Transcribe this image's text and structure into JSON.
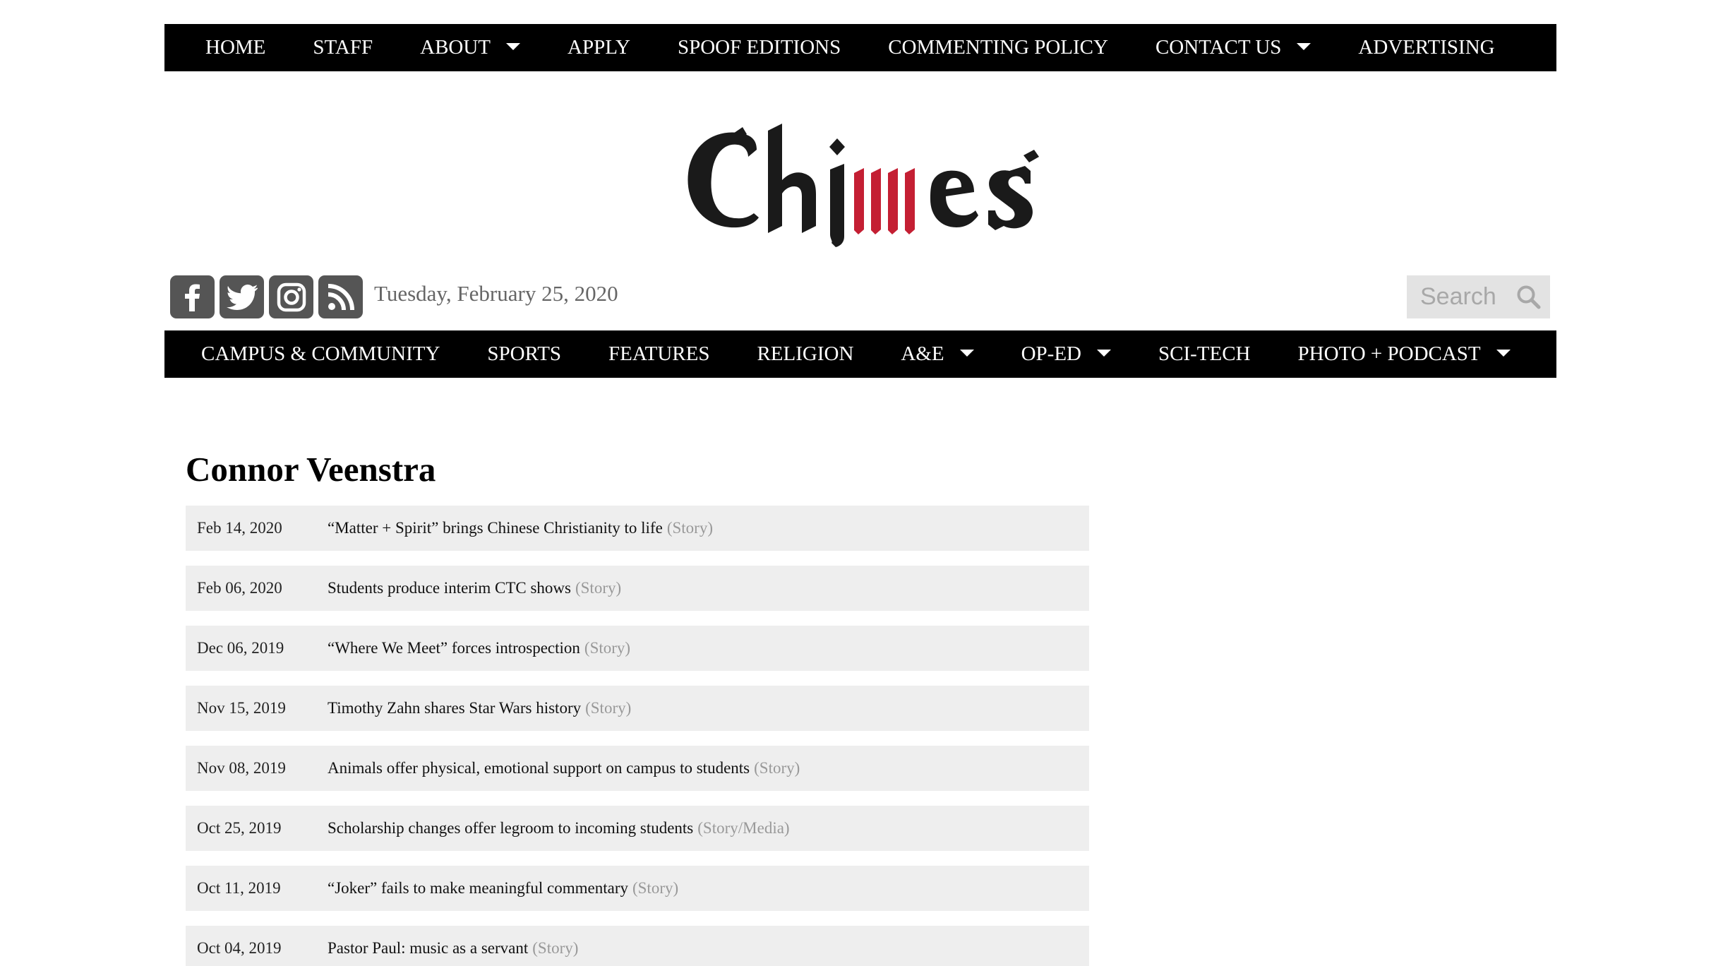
{
  "top_nav": [
    {
      "label": "HOME",
      "has_dropdown": false
    },
    {
      "label": "STAFF",
      "has_dropdown": false
    },
    {
      "label": "ABOUT",
      "has_dropdown": true
    },
    {
      "label": "APPLY",
      "has_dropdown": false
    },
    {
      "label": "SPOOF EDITIONS",
      "has_dropdown": false
    },
    {
      "label": "COMMENTING POLICY",
      "has_dropdown": false
    },
    {
      "label": "CONTACT US",
      "has_dropdown": true
    },
    {
      "label": "ADVERTISING",
      "has_dropdown": false
    }
  ],
  "logo": {
    "text": "Chimes",
    "accent_color": "#c41f33",
    "ink_color": "#1a1a1a"
  },
  "social": [
    {
      "icon": "facebook-icon"
    },
    {
      "icon": "twitter-icon"
    },
    {
      "icon": "instagram-icon"
    },
    {
      "icon": "rss-icon"
    }
  ],
  "date": "Tuesday, February 25, 2020",
  "search": {
    "placeholder": "Search",
    "icon": "search-icon"
  },
  "category_nav": [
    {
      "label": "CAMPUS & COMMUNITY",
      "has_dropdown": false
    },
    {
      "label": "SPORTS",
      "has_dropdown": false
    },
    {
      "label": "FEATURES",
      "has_dropdown": false
    },
    {
      "label": "RELIGION",
      "has_dropdown": false
    },
    {
      "label": "A&E",
      "has_dropdown": true
    },
    {
      "label": "OP-ED",
      "has_dropdown": true
    },
    {
      "label": "SCI-TECH",
      "has_dropdown": false
    },
    {
      "label": "PHOTO + PODCAST",
      "has_dropdown": true
    }
  ],
  "page_title": "Connor Veenstra",
  "articles": [
    {
      "date": "Feb 14, 2020",
      "title": "“Matter + Spirit” brings Chinese Christianity to life",
      "type": "(Story)"
    },
    {
      "date": "Feb 06, 2020",
      "title": "Students produce interim CTC shows",
      "type": "(Story)"
    },
    {
      "date": "Dec 06, 2019",
      "title": "“Where We Meet” forces introspection",
      "type": "(Story)"
    },
    {
      "date": "Nov 15, 2019",
      "title": "Timothy Zahn shares Star Wars history",
      "type": "(Story)"
    },
    {
      "date": "Nov 08, 2019",
      "title": "Animals offer physical, emotional support on campus to students",
      "type": "(Story)"
    },
    {
      "date": "Oct 25, 2019",
      "title": "Scholarship changes offer legroom to incoming students",
      "type": "(Story/Media)"
    },
    {
      "date": "Oct 11, 2019",
      "title": "“Joker” fails to make meaningful commentary",
      "type": "(Story)"
    },
    {
      "date": "Oct 04, 2019",
      "title": "Pastor Paul: music as a servant",
      "type": "(Story)"
    }
  ]
}
